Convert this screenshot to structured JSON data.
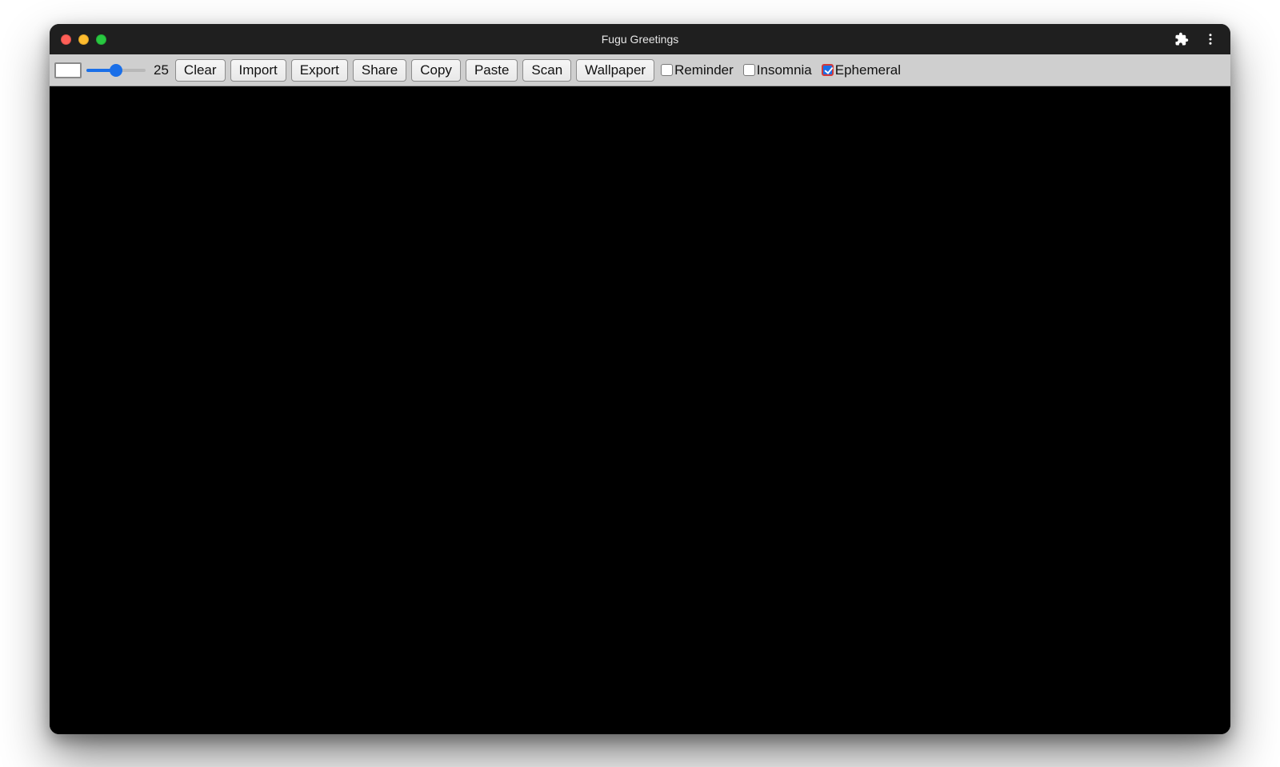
{
  "window": {
    "title": "Fugu Greetings"
  },
  "toolbar": {
    "slider": {
      "value": 25,
      "min": 0,
      "max": 50,
      "percent": 50
    },
    "buttons": {
      "clear": "Clear",
      "import": "Import",
      "export": "Export",
      "share": "Share",
      "copy": "Copy",
      "paste": "Paste",
      "scan": "Scan",
      "wallpaper": "Wallpaper"
    },
    "checkboxes": {
      "reminder": {
        "label": "Reminder",
        "checked": false
      },
      "insomnia": {
        "label": "Insomnia",
        "checked": false
      },
      "ephemeral": {
        "label": "Ephemeral",
        "checked": true
      }
    },
    "color_swatch": "#ffffff"
  },
  "icons": {
    "extension": "extension-puzzle-icon",
    "more": "more-vertical-icon"
  },
  "colors": {
    "accent": "#1a6fe8",
    "titlebar": "#1f1f1f",
    "toolbar": "#cfcfcf",
    "canvas": "#000000",
    "checkbox_outline_focus": "#d23a3a"
  }
}
